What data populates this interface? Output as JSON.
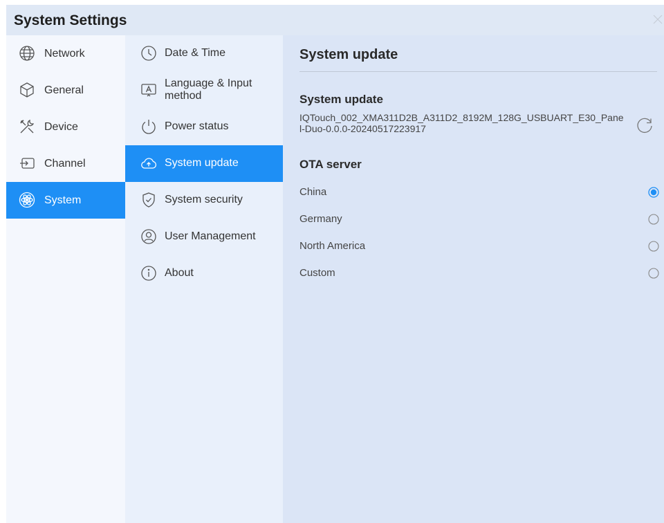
{
  "window": {
    "title": "System Settings"
  },
  "sidebar": {
    "items": [
      {
        "label": "Network",
        "icon": "globe-icon"
      },
      {
        "label": "General",
        "icon": "cube-icon"
      },
      {
        "label": "Device",
        "icon": "tools-icon"
      },
      {
        "label": "Channel",
        "icon": "input-icon"
      },
      {
        "label": "System",
        "icon": "atom-icon",
        "active": true
      }
    ]
  },
  "submenu": {
    "items": [
      {
        "label": "Date & Time",
        "icon": "clock-icon"
      },
      {
        "label": "Language & Input method",
        "icon": "keyboard-a-icon"
      },
      {
        "label": "Power status",
        "icon": "power-icon"
      },
      {
        "label": "System update",
        "icon": "cloud-upload-icon",
        "active": true
      },
      {
        "label": "System security",
        "icon": "shield-icon"
      },
      {
        "label": "User Management",
        "icon": "user-icon"
      },
      {
        "label": "About",
        "icon": "info-icon"
      }
    ]
  },
  "main": {
    "title": "System update",
    "update_section": {
      "heading": "System update",
      "version": "IQTouch_002_XMA311D2B_A311D2_8192M_128G_USBUART_E30_Panel-Duo-0.0.0-20240517223917"
    },
    "ota_section": {
      "heading": "OTA server",
      "options": [
        {
          "label": "China",
          "selected": true
        },
        {
          "label": "Germany",
          "selected": false
        },
        {
          "label": "North America",
          "selected": false
        },
        {
          "label": "Custom",
          "selected": false
        }
      ]
    }
  },
  "colors": {
    "accent": "#1e8ff5",
    "panel_bg": "#dbe5f6",
    "sidebar_bg": "#f4f7fd"
  }
}
